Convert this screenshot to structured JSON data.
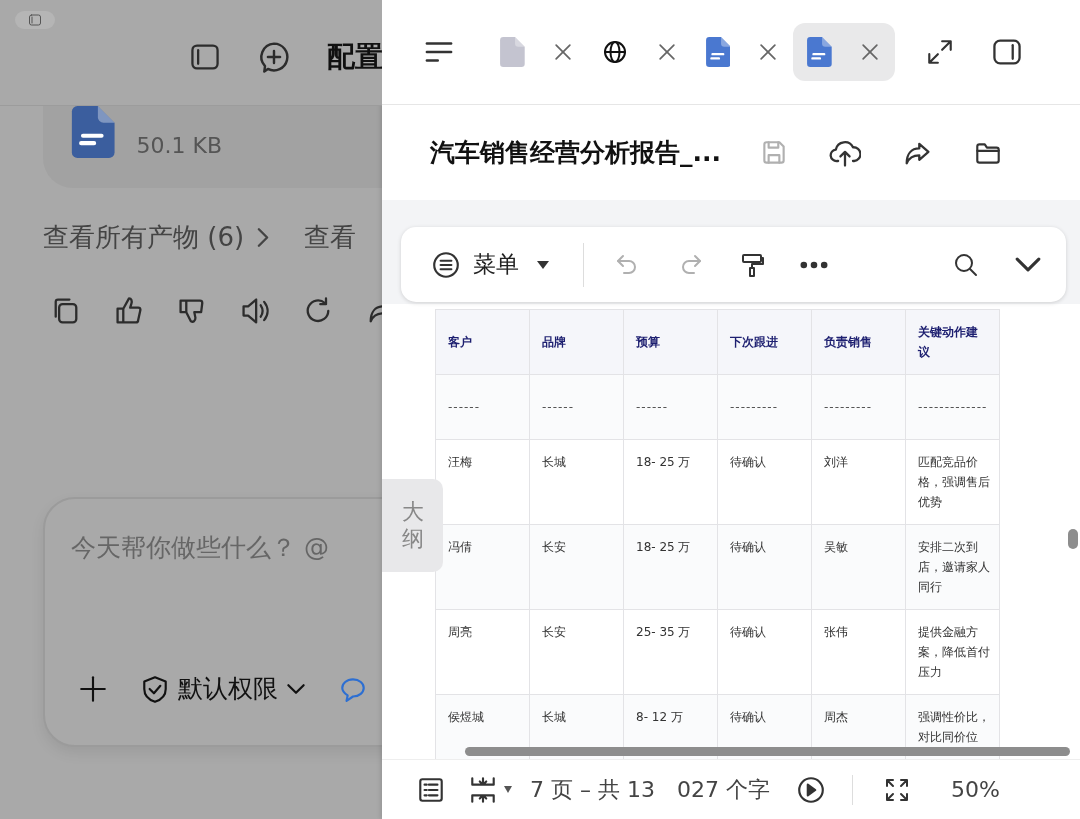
{
  "left_pane": {
    "header_title": "配置",
    "file_card": {
      "size": "50.1 KB"
    },
    "links": [
      "查看所有产物 (6)",
      "查看"
    ],
    "composer": {
      "placeholder": "今天帮你做些什么？ @",
      "permission": "默认权限"
    }
  },
  "tabs": [
    {
      "kind": "file",
      "selected": false
    },
    {
      "kind": "globe",
      "selected": false
    },
    {
      "kind": "doc",
      "selected": false
    },
    {
      "kind": "doc",
      "selected": true
    }
  ],
  "document": {
    "title": "汽车销售经营分析报告_..."
  },
  "toolbar": {
    "menu": "菜单"
  },
  "outline_tab": "大纲",
  "table": {
    "columns": [
      "客户",
      "品牌",
      "预算",
      "下次跟进",
      "负责销售",
      "关键动作建议"
    ],
    "rows": [
      [
        "------",
        "------",
        "------",
        "---------",
        "---------",
        "-------------"
      ],
      [
        "汪梅",
        "长城",
        "18- 25 万",
        "待确认",
        "刘洋",
        "匹配竞品价格，强调售后优势"
      ],
      [
        "冯倩",
        "长安",
        "18- 25 万",
        "待确认",
        "吴敏",
        "安排二次到店，邀请家人同行"
      ],
      [
        "周亮",
        "长安",
        "25- 35 万",
        "待确认",
        "张伟",
        "提供金融方案，降低首付压力"
      ],
      [
        "侯煜城",
        "长城",
        "8- 12 万",
        "待确认",
        "周杰",
        "强调性价比，对比同价位"
      ]
    ]
  },
  "status_bar": {
    "page": "7 页 – 共 13",
    "words": "027 个字",
    "zoom": "50%"
  }
}
